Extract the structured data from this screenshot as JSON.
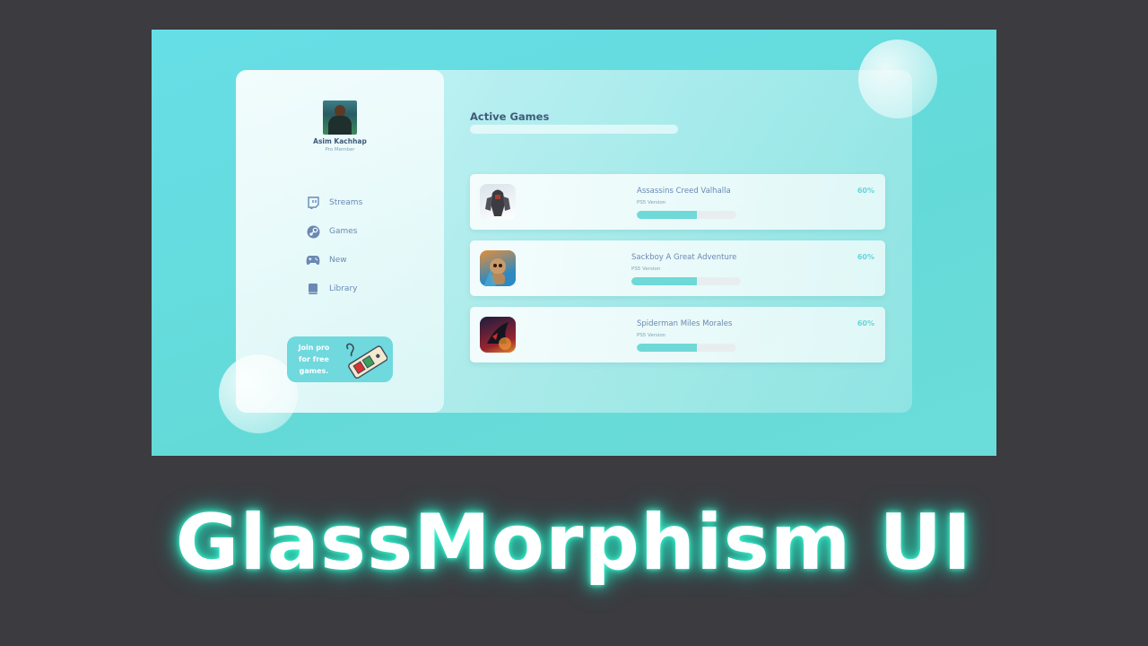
{
  "profile": {
    "name": "Asim Kachhap",
    "role": "Pro Member"
  },
  "nav": [
    {
      "label": "Streams",
      "icon": "twitch-icon"
    },
    {
      "label": "Games",
      "icon": "steam-icon"
    },
    {
      "label": "New",
      "icon": "gamepad-icon"
    },
    {
      "label": "Library",
      "icon": "book-icon"
    }
  ],
  "promo": {
    "text": "Join pro\nfor free\ngames.",
    "icon": "retro-controller-icon"
  },
  "main": {
    "section_title": "Active Games"
  },
  "games": [
    {
      "title": "Assassins Creed Valhalla",
      "subtitle": "PS5 Version",
      "percent_label": "60%",
      "progress": 0.6
    },
    {
      "title": "Sackboy A Great Adventure",
      "subtitle": "PS5 Version",
      "percent_label": "60%",
      "progress": 0.6
    },
    {
      "title": "Spiderman Miles Morales",
      "subtitle": "PS5 Version",
      "percent_label": "60%",
      "progress": 0.6
    }
  ],
  "banner": {
    "headline": "GlassMorphism UI"
  },
  "colors": {
    "accent": "#6fd9d8",
    "text_dark": "#3e5a7a",
    "text_nav": "#6a89b4",
    "glow": "#2fe6c4",
    "backdrop": "#3b3b40"
  }
}
